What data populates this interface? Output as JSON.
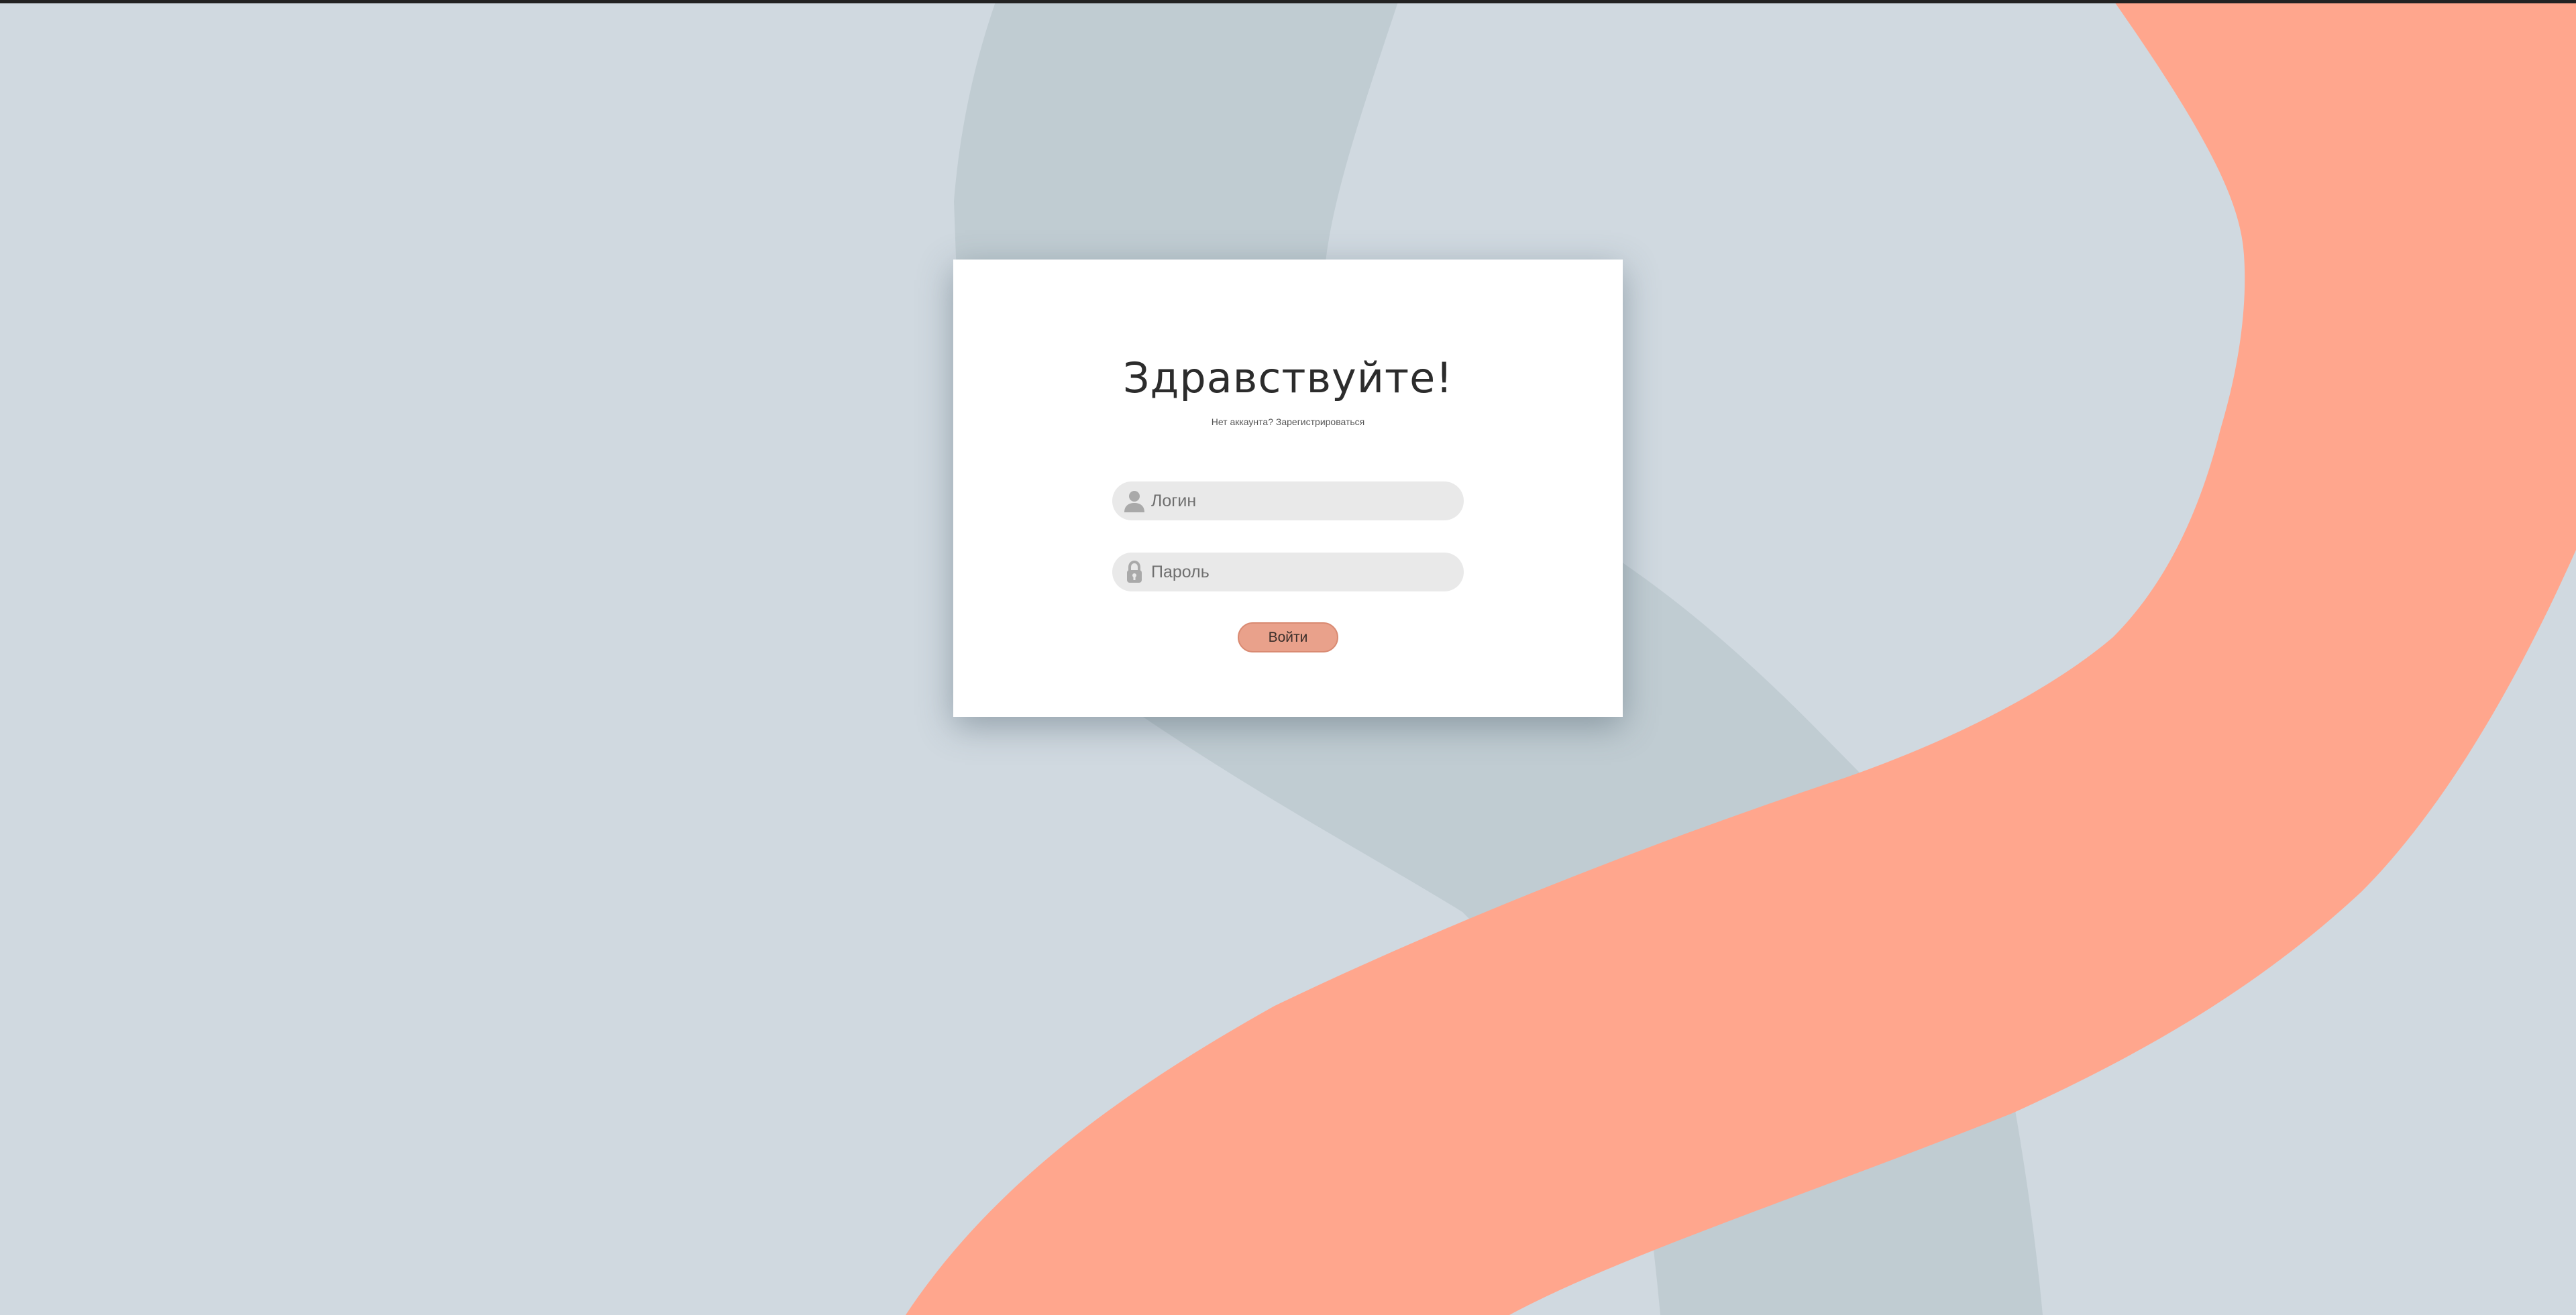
{
  "login_form": {
    "title": "Здравствуйте!",
    "subtitle": "Нет аккаунта? Зарегистрироваться",
    "login_field": {
      "placeholder": "Логин",
      "value": "",
      "icon": "user-icon"
    },
    "password_field": {
      "placeholder": "Пароль",
      "value": "",
      "icon": "lock-icon"
    },
    "submit_label": "Войти"
  },
  "colors": {
    "background": "#d0d9e0",
    "grey_ribbon": "#c0ccd2",
    "accent_ribbon": "#ffa68d",
    "card": "#ffffff",
    "field": "#e9e9e9",
    "button": "#e9a18b"
  }
}
